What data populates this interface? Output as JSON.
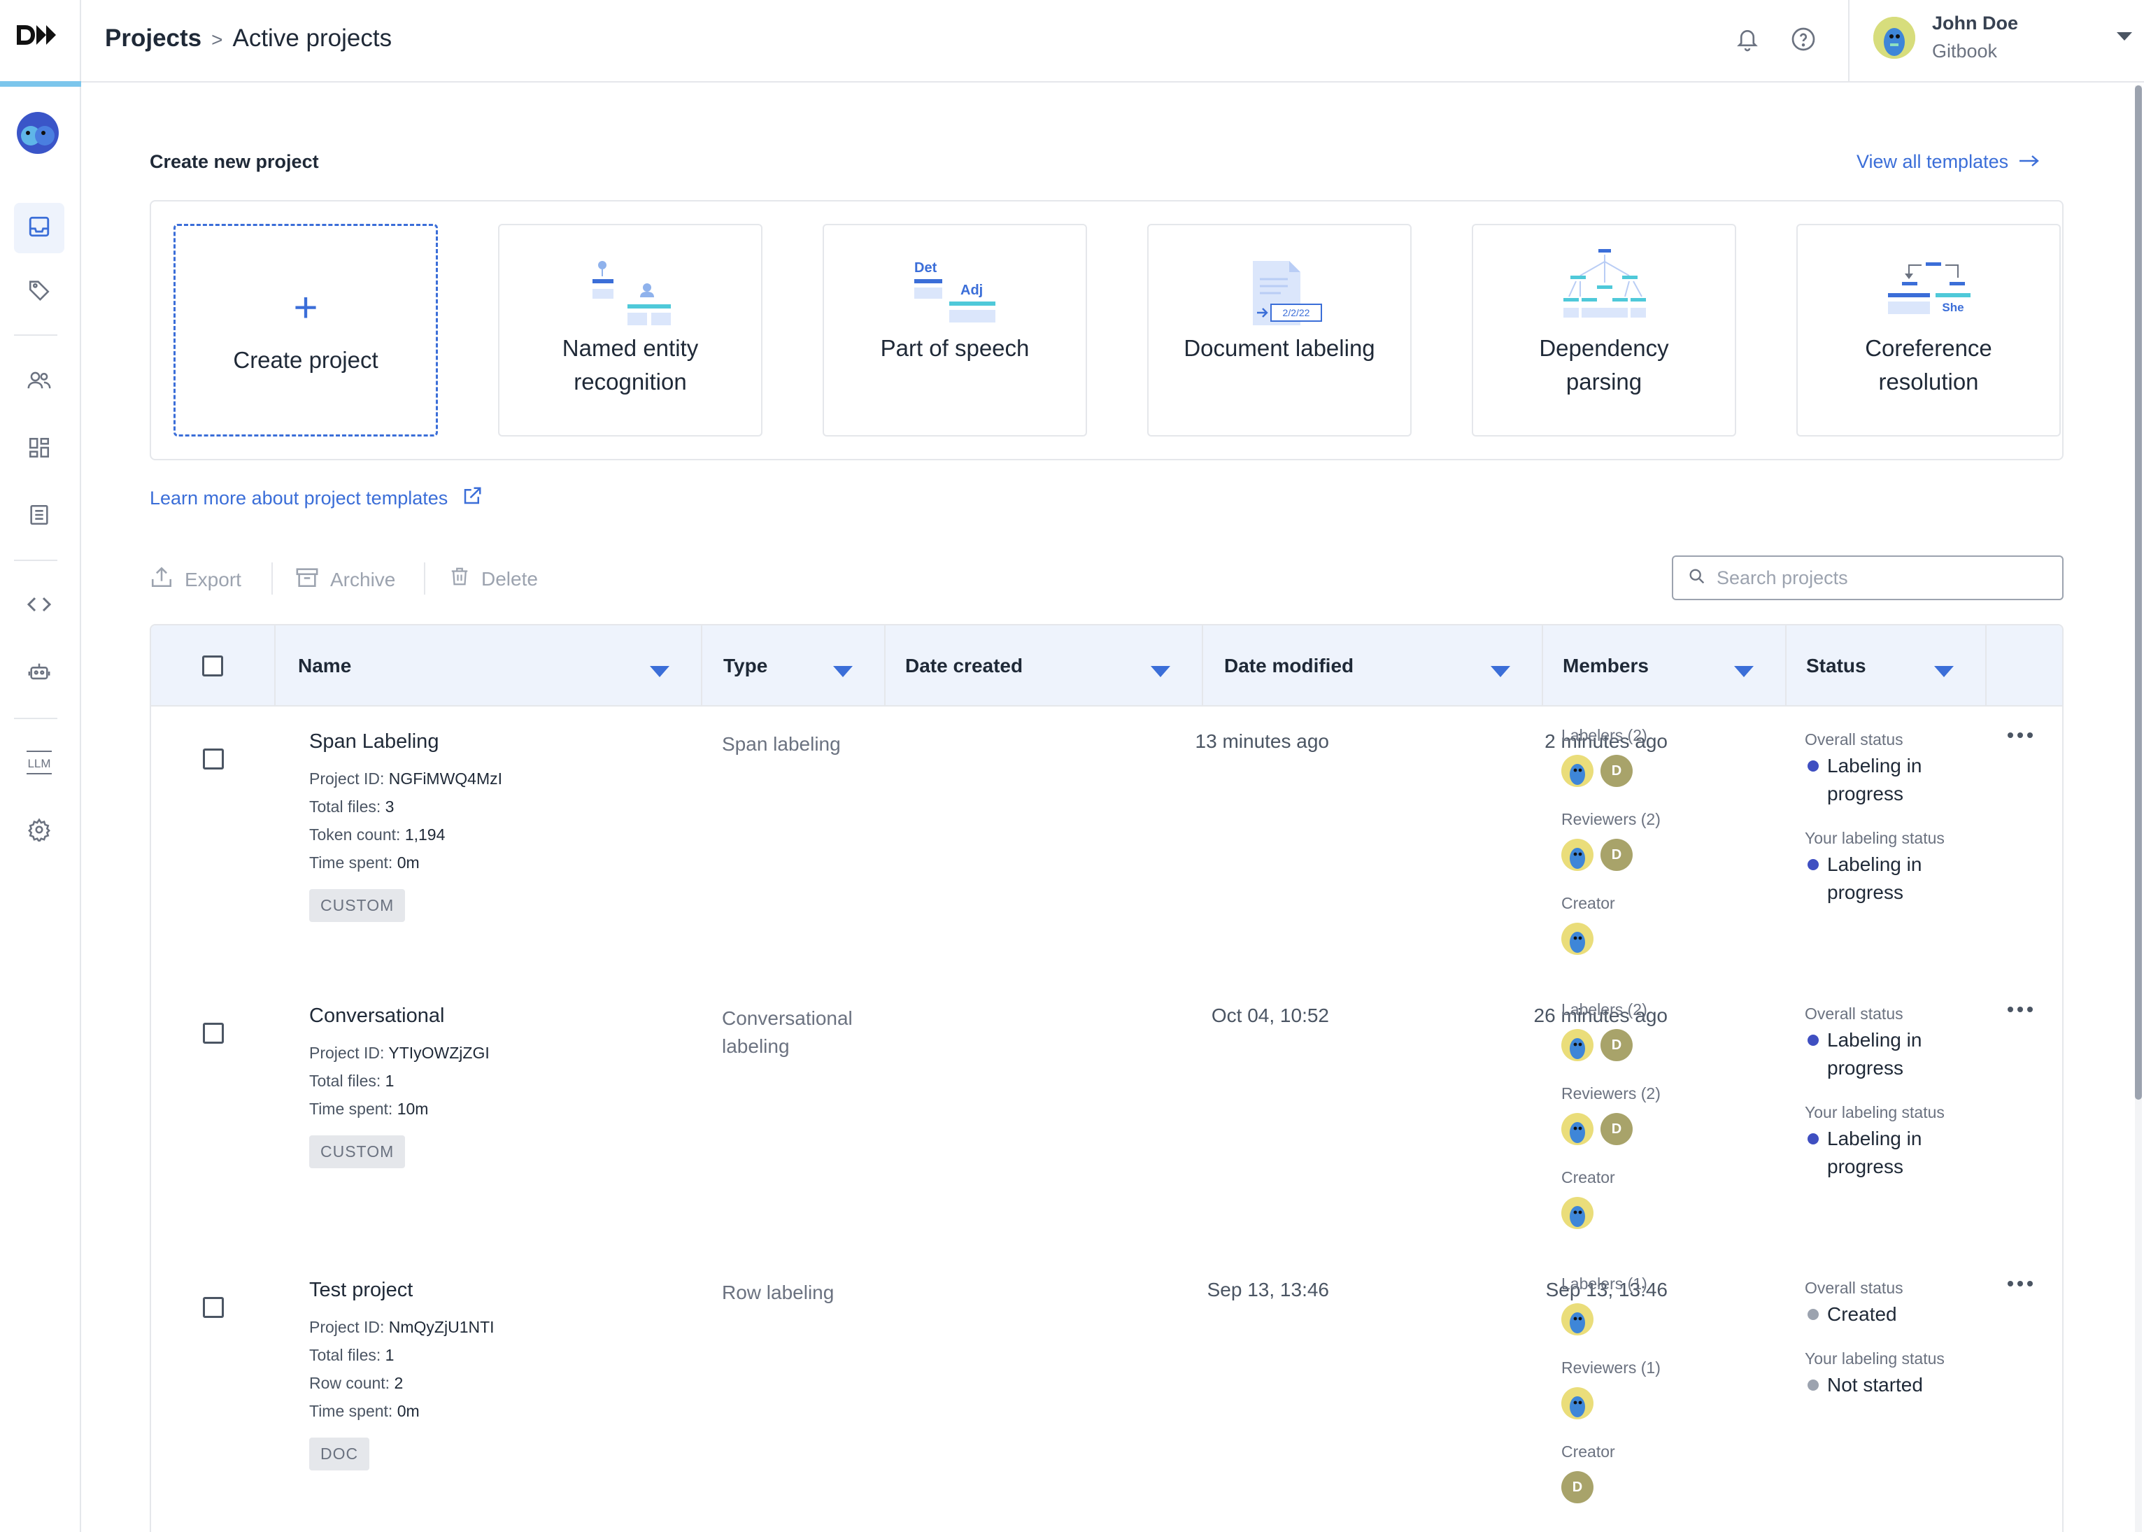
{
  "breadcrumb": {
    "root": "Projects",
    "separator": ">",
    "current": "Active projects"
  },
  "user": {
    "name": "John Doe",
    "org": "Gitbook"
  },
  "sidebar": {
    "items": [
      {
        "icon": "inbox-icon",
        "active": true
      },
      {
        "icon": "tag-icon"
      },
      {
        "icon": "users-icon"
      },
      {
        "icon": "dashboard-icon"
      },
      {
        "icon": "document-list-icon"
      },
      {
        "icon": "code-icon"
      },
      {
        "icon": "robot-icon"
      },
      {
        "icon": "llm-icon",
        "label": "LLM"
      },
      {
        "icon": "gear-icon"
      }
    ]
  },
  "create": {
    "title": "Create new project",
    "view_all": "View all templates",
    "create_label": "Create project",
    "templates": [
      {
        "label": "Named entity recognition"
      },
      {
        "label": "Part of speech",
        "det": "Det",
        "adj": "Adj"
      },
      {
        "label": "Document labeling",
        "date": "2/2/22"
      },
      {
        "label": "Dependency parsing"
      },
      {
        "label": "Coreference resolution",
        "she": "She"
      }
    ],
    "learn_more": "Learn more about project templates"
  },
  "toolbar": {
    "export": "Export",
    "archive": "Archive",
    "delete": "Delete",
    "search_placeholder": "Search projects"
  },
  "table": {
    "columns": [
      "Name",
      "Type",
      "Date created",
      "Date modified",
      "Members",
      "Status"
    ],
    "meta_labels": {
      "project_id": "Project ID:",
      "total_files": "Total files:",
      "token_count": "Token count:",
      "row_count": "Row count:",
      "time_spent": "Time spent:"
    },
    "member_labels": {
      "creator": "Creator"
    },
    "status_labels": {
      "overall": "Overall status",
      "yours": "Your labeling status"
    },
    "rows": [
      {
        "name": "Span Labeling",
        "project_id": "NGFiMWQ4MzI",
        "total_files": "3",
        "token_count": "1,194",
        "time_spent": "0m",
        "tag": "CUSTOM",
        "type": "Span labeling",
        "created": "13 minutes ago",
        "modified": "2 minutes ago",
        "labelers": "Labelers (2)",
        "reviewers": "Reviewers (2)",
        "overall_status": "Labeling in progress",
        "your_status": "Labeling in progress",
        "overall_color": "#3f4fc1",
        "your_color": "#3f4fc1"
      },
      {
        "name": "Conversational",
        "project_id": "YTIyOWZjZGI",
        "total_files": "1",
        "time_spent": "10m",
        "tag": "CUSTOM",
        "type": "Conversational labeling",
        "created": "Oct 04, 10:52",
        "modified": "26 minutes ago",
        "labelers": "Labelers (2)",
        "reviewers": "Reviewers (2)",
        "overall_status": "Labeling in progress",
        "your_status": "Labeling in progress",
        "overall_color": "#3f4fc1",
        "your_color": "#3f4fc1"
      },
      {
        "name": "Test project",
        "project_id": "NmQyZjU1NTI",
        "total_files": "1",
        "row_count": "2",
        "time_spent": "0m",
        "tag": "DOC",
        "type": "Row labeling",
        "created": "Sep 13, 13:46",
        "modified": "Sep 13, 13:46",
        "labelers": "Labelers (1)",
        "reviewers": "Reviewers (1)",
        "overall_status": "Created",
        "your_status": "Not started",
        "overall_color": "#9ca3af",
        "your_color": "#9ca3af"
      }
    ]
  },
  "colors": {
    "accent": "#3b6ed8",
    "header_bg": "#eef3fc"
  }
}
